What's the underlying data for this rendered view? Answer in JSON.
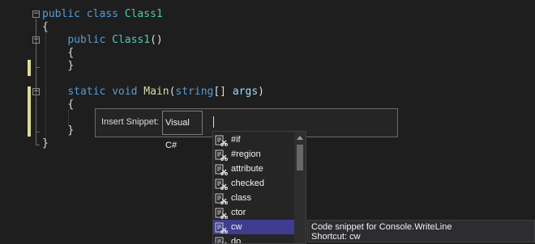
{
  "code": {
    "line1": {
      "kw1": "public",
      "kw2": "class",
      "name": "Class1"
    },
    "line2": "{",
    "line3": {
      "kw": "public",
      "name": "Class1",
      "punct": "()"
    },
    "line4": "{",
    "line5": "}",
    "line7": {
      "kw1": "static",
      "kw2": "void",
      "method": "Main",
      "open": "(",
      "type": "string",
      "arr": "[] ",
      "param": "args",
      "close": ")"
    },
    "line8": "{",
    "line10": "}",
    "line11": "}"
  },
  "snippet": {
    "label": "Insert Snippet:",
    "chip": "Visual C#"
  },
  "completion": {
    "items": [
      "#if",
      "#region",
      "attribute",
      "checked",
      "class",
      "ctor",
      "cw",
      "do"
    ],
    "selected_index": 6,
    "icon": "snippet-icon"
  },
  "tooltip": {
    "title": "Code snippet for Console.WriteLine",
    "shortcut": "Shortcut: cw"
  },
  "colors": {
    "background": "#1e1e1e",
    "keyword": "#569cd6",
    "type": "#4ec9b0",
    "method": "#dcdcaa",
    "parameter": "#9cdcfe",
    "selection": "#3e3d8f"
  }
}
